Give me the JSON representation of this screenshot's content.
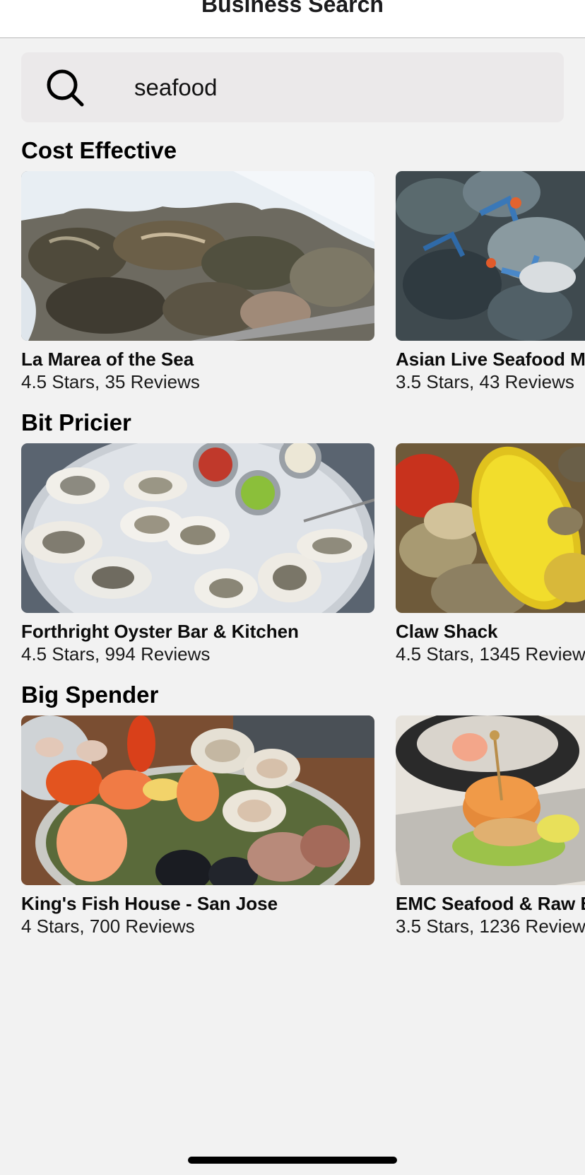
{
  "header": {
    "title": "Business Search"
  },
  "search": {
    "value": "seafood",
    "placeholder": "Search"
  },
  "sections": [
    {
      "title": "Cost Effective",
      "cards": [
        {
          "name": "La Marea of the Sea",
          "rating": "4.5 Stars, 35 Reviews",
          "image": "oysters-on-ice-photo"
        },
        {
          "name": "Asian Live Seafood M",
          "rating": "3.5 Stars, 43 Reviews",
          "image": "blue-crabs-photo"
        }
      ]
    },
    {
      "title": "Bit Pricier",
      "cards": [
        {
          "name": "Forthright Oyster Bar & Kitchen",
          "rating": "4.5 Stars, 994 Reviews",
          "image": "oyster-platter-photo"
        },
        {
          "name": "Claw Shack",
          "rating": "4.5 Stars, 1345 Review",
          "image": "crawfish-corn-boil-photo"
        }
      ]
    },
    {
      "title": "Big Spender",
      "cards": [
        {
          "name": "King's Fish House - San Jose",
          "rating": "4 Stars, 700 Reviews",
          "image": "seafood-tower-photo"
        },
        {
          "name": "EMC Seafood & Raw B",
          "rating": "3.5 Stars, 1236 Review",
          "image": "slider-burger-photo"
        }
      ]
    }
  ],
  "colors": {
    "background": "#f2f2f2",
    "search_bg": "#ebe9ea",
    "navbar": "#ffffff"
  }
}
